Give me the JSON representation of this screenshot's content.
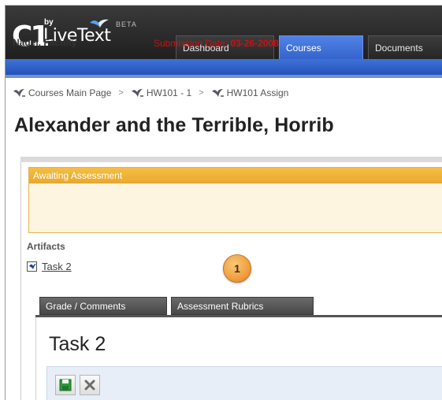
{
  "brand": {
    "logo_mark": "C1",
    "by": "by",
    "name": "LiveText",
    "beta": "BETA"
  },
  "nav": {
    "tabs": [
      {
        "label": "Dashboard",
        "active": false
      },
      {
        "label": "Courses",
        "active": true
      },
      {
        "label": "Documents",
        "active": false
      }
    ]
  },
  "breadcrumb": {
    "items": [
      "Courses Main Page",
      "HW101 - 1",
      "HW101 Assign"
    ],
    "separator": ">"
  },
  "page": {
    "title": "Alexander and the Terrible, Horrib"
  },
  "status": {
    "header": "Awaiting Assessment",
    "reviewer": "Nagel, Faculty",
    "submission_label": "Submission Date: ",
    "submission_date": "03-26-2008"
  },
  "artifacts": {
    "title": "Artifacts",
    "items": [
      "Task 2"
    ]
  },
  "callout": {
    "number": "1"
  },
  "subtabs": [
    {
      "label": "Grade / Comments"
    },
    {
      "label": "Assessment Rubrics"
    }
  ],
  "task": {
    "title": "Task 2"
  },
  "toolbar": {
    "save_icon": "save-icon",
    "cancel_icon": "close-icon"
  },
  "colors": {
    "nav_active": "#3565cc",
    "status_header": "#f0b238",
    "submission_text": "#cc1111",
    "callout": "#ef9b3c"
  }
}
